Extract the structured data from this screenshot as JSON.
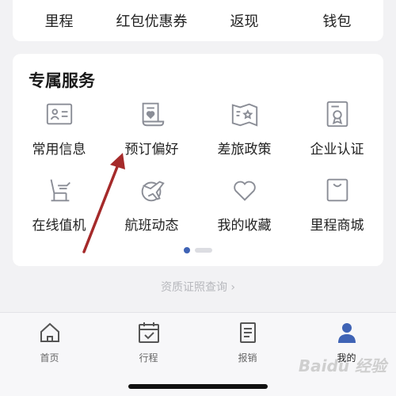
{
  "top_row": {
    "items": [
      "里程",
      "红包优惠券",
      "返现",
      "钱包"
    ]
  },
  "services": {
    "title": "专属服务",
    "items": [
      {
        "label": "常用信息",
        "icon": "id-card-icon"
      },
      {
        "label": "预订偏好",
        "icon": "document-heart-icon"
      },
      {
        "label": "差旅政策",
        "icon": "map-star-icon"
      },
      {
        "label": "企业认证",
        "icon": "certificate-icon"
      },
      {
        "label": "在线值机",
        "icon": "seat-icon"
      },
      {
        "label": "航班动态",
        "icon": "plane-icon"
      },
      {
        "label": "我的收藏",
        "icon": "heart-icon"
      },
      {
        "label": "里程商城",
        "icon": "shopping-bag-icon"
      }
    ],
    "pager": {
      "pages": 2,
      "current": 1
    }
  },
  "qualification_link": "资质证照查询 ›",
  "bottom_nav": {
    "items": [
      {
        "label": "首页",
        "icon": "home-icon"
      },
      {
        "label": "行程",
        "icon": "calendar-check-icon"
      },
      {
        "label": "报销",
        "icon": "receipt-icon"
      },
      {
        "label": "我的",
        "icon": "person-icon"
      }
    ],
    "active_index": 3
  },
  "watermark": "Baidu 经验",
  "colors": {
    "accent": "#3f63b5",
    "annotation_arrow": "#a52a2a",
    "icon_stroke": "#8a8d96"
  }
}
